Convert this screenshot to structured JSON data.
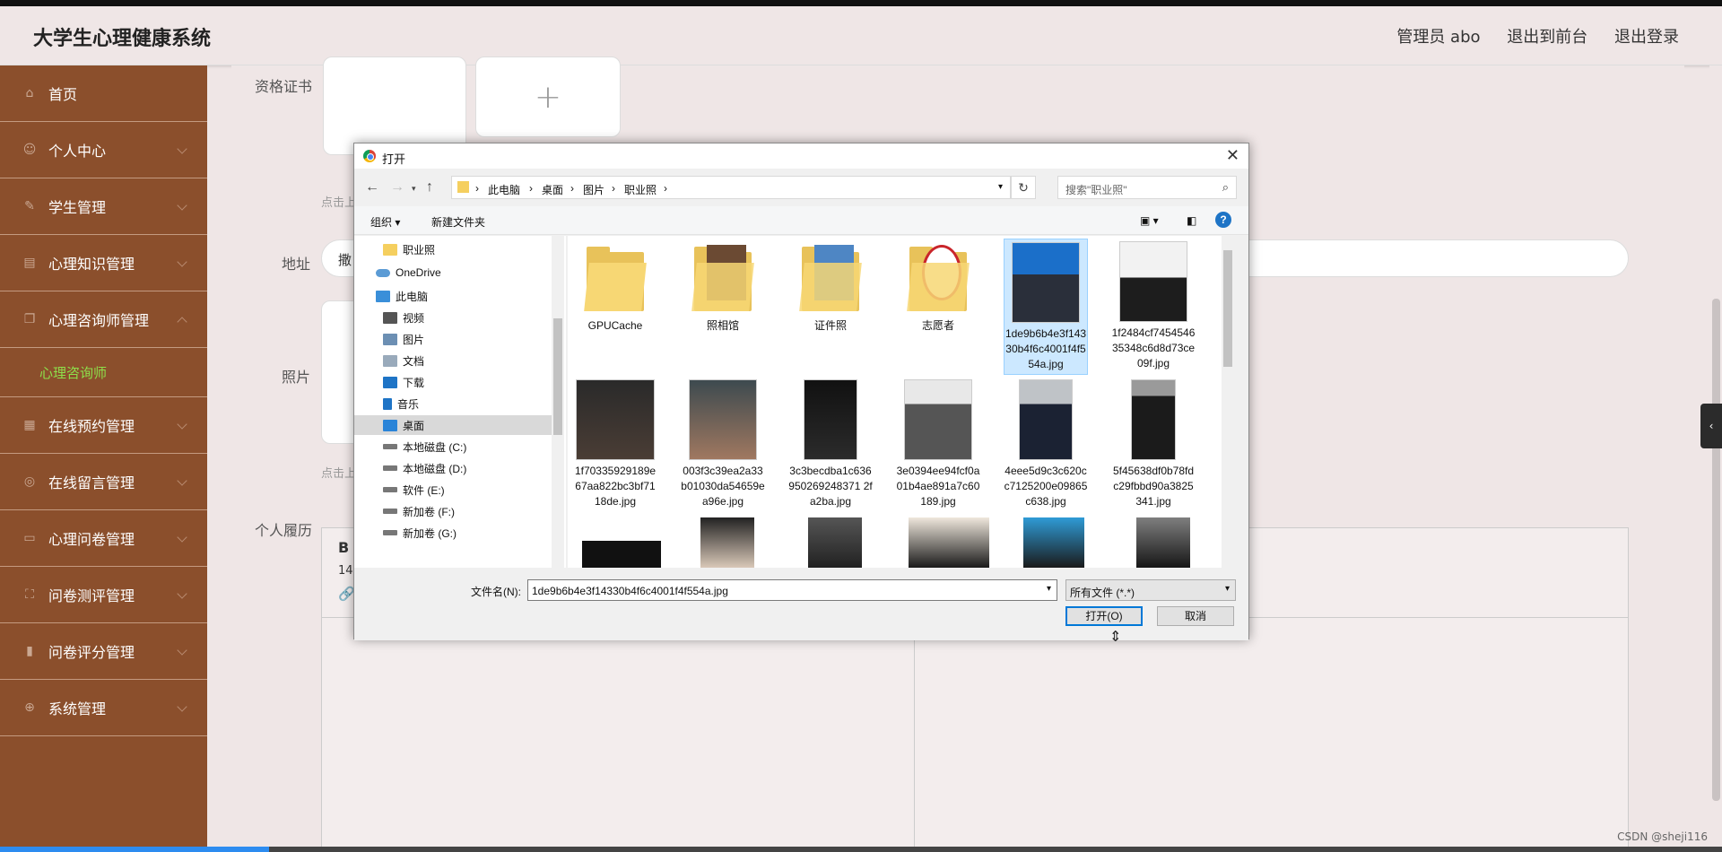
{
  "header": {
    "app_title": "大学生心理健康系统",
    "user": "管理员 abo",
    "to_front": "退出到前台",
    "logout": "退出登录"
  },
  "sidebar": {
    "items": [
      {
        "label": "首页",
        "icon": "home-icon"
      },
      {
        "label": "个人中心",
        "icon": "user-icon"
      },
      {
        "label": "学生管理",
        "icon": "edit-icon"
      },
      {
        "label": "心理知识管理",
        "icon": "clipboard-icon"
      },
      {
        "label": "心理咨询师管理",
        "icon": "copy-icon",
        "expanded": true
      },
      {
        "label": "在线预约管理",
        "icon": "grid-icon"
      },
      {
        "label": "在线留言管理",
        "icon": "target-icon"
      },
      {
        "label": "心理问卷管理",
        "icon": "monitor-icon"
      },
      {
        "label": "问卷测评管理",
        "icon": "expand-icon"
      },
      {
        "label": "问卷评分管理",
        "icon": "bar-chart-icon"
      },
      {
        "label": "系统管理",
        "icon": "crosshair-icon"
      }
    ],
    "sub_item": "心理咨询师"
  },
  "form": {
    "cert_label": "资格证书",
    "address_label": "地址",
    "address_value": "撒",
    "photo_label": "照片",
    "resume_label": "个人履历",
    "upload_tip_1": "点击上",
    "upload_tip_2": "点击上",
    "editor_bold": "B",
    "editor_size": "14"
  },
  "dialog": {
    "title": "打开",
    "breadcrumb": [
      "此电脑",
      "桌面",
      "图片",
      "职业照"
    ],
    "search_placeholder": "搜索\"职业照\"",
    "organize": "组织 ▾",
    "new_folder": "新建文件夹",
    "nav_items": [
      {
        "label": "职业照",
        "icon": "folder-icon"
      },
      {
        "label": "OneDrive",
        "icon": "cloud-icon"
      },
      {
        "label": "此电脑",
        "icon": "computer-icon"
      },
      {
        "label": "视频",
        "icon": "video-icon"
      },
      {
        "label": "图片",
        "icon": "picture-icon"
      },
      {
        "label": "文档",
        "icon": "document-icon"
      },
      {
        "label": "下载",
        "icon": "download-icon"
      },
      {
        "label": "音乐",
        "icon": "music-icon"
      },
      {
        "label": "桌面",
        "icon": "desktop-icon",
        "selected": true
      },
      {
        "label": "本地磁盘 (C:)",
        "icon": "drive-icon"
      },
      {
        "label": "本地磁盘 (D:)",
        "icon": "drive-icon"
      },
      {
        "label": "软件 (E:)",
        "icon": "drive-icon"
      },
      {
        "label": "新加卷 (F:)",
        "icon": "drive-icon"
      },
      {
        "label": "新加卷 (G:)",
        "icon": "drive-icon"
      }
    ],
    "files_row1": [
      {
        "name": "GPUCache",
        "type": "folder"
      },
      {
        "name": "照相馆",
        "type": "folder"
      },
      {
        "name": "证件照",
        "type": "folder"
      },
      {
        "name": "志愿者",
        "type": "folder"
      },
      {
        "name": "1de9b6b4e3f14330b4f6c4001f4f554a.jpg",
        "type": "image",
        "selected": true
      },
      {
        "name": "1f2484cf745454635348c6d8d73ce09f.jpg",
        "type": "image"
      }
    ],
    "files_row2": [
      {
        "name": "1f70335929189e67aa822bc3bf7118de.jpg",
        "type": "image"
      },
      {
        "name": "003f3c39ea2a33b01030da54659ea96e.jpg",
        "type": "image"
      },
      {
        "name": "3c3becdba1c636950269248371 2fa2ba.jpg",
        "type": "image"
      },
      {
        "name": "3e0394ee94fcf0a01b4ae891a7c60189.jpg",
        "type": "image"
      },
      {
        "name": "4eee5d9c3c620cc7125200e09865c638.jpg",
        "type": "image"
      },
      {
        "name": "5f45638df0b78fdc29fbbd90a3825341.jpg",
        "type": "image"
      }
    ],
    "filename_label": "文件名(N):",
    "filename_value": "1de9b6b4e3f14330b4f6c4001f4f554a.jpg",
    "filetype_value": "所有文件 (*.*)",
    "open_button": "打开(O)",
    "cancel_button": "取消"
  },
  "watermark": "CSDN @sheji116",
  "colors": {
    "sidebar": "#8b4f2c",
    "active_sub": "#8de04b",
    "selection": "#cce8ff"
  }
}
